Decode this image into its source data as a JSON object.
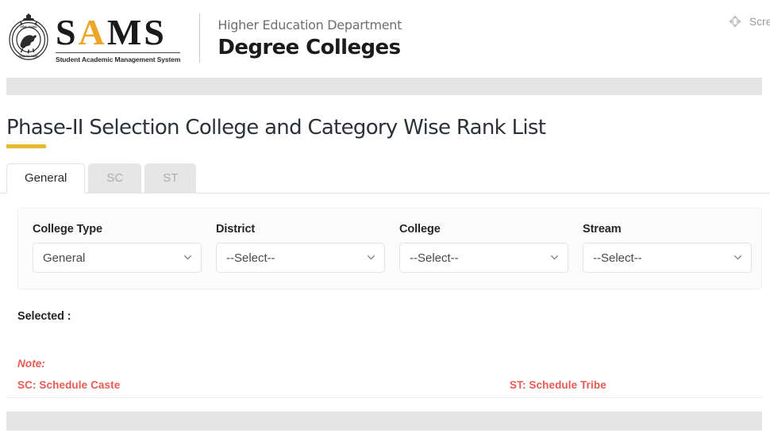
{
  "header": {
    "emblem_icon": "odisha-state-emblem",
    "logo_main_left": "S",
    "logo_main_accent": "A",
    "logo_main_right": "MS",
    "logo_subtitle": "Student Academic Management System",
    "department": "Higher Education Department",
    "portal_name": "Degree Colleges",
    "accent_color": "#eda526",
    "screen_reader": {
      "icon": "screen-reader-icon",
      "label": "Screen"
    }
  },
  "page": {
    "title": "Phase-II Selection College and Category Wise Rank List",
    "title_rule_color": "#e9b830"
  },
  "tabs": [
    {
      "id": "general",
      "label": "General",
      "active": true
    },
    {
      "id": "sc",
      "label": "SC",
      "active": false
    },
    {
      "id": "st",
      "label": "ST",
      "active": false
    }
  ],
  "filters": {
    "college_type": {
      "label": "College Type",
      "value": "General",
      "placeholder": "--Select--",
      "options": [
        "General",
        "--Select--"
      ]
    },
    "district": {
      "label": "District",
      "value": "--Select--",
      "placeholder": "--Select--",
      "options": [
        "--Select--"
      ]
    },
    "college": {
      "label": "College",
      "value": "--Select--",
      "placeholder": "--Select--",
      "options": [
        "--Select--"
      ]
    },
    "stream": {
      "label": "Stream",
      "value": "--Select--",
      "placeholder": "--Select--",
      "options": [
        "--Select--"
      ]
    },
    "submit_label": "",
    "submit_color": "#4e9a80"
  },
  "selected": {
    "label": "Selected :",
    "value": ""
  },
  "note": {
    "title": "Note:",
    "sc": "SC:  Schedule Caste",
    "st": "ST:  Schedule Tribe",
    "color": "#ea5a52"
  }
}
